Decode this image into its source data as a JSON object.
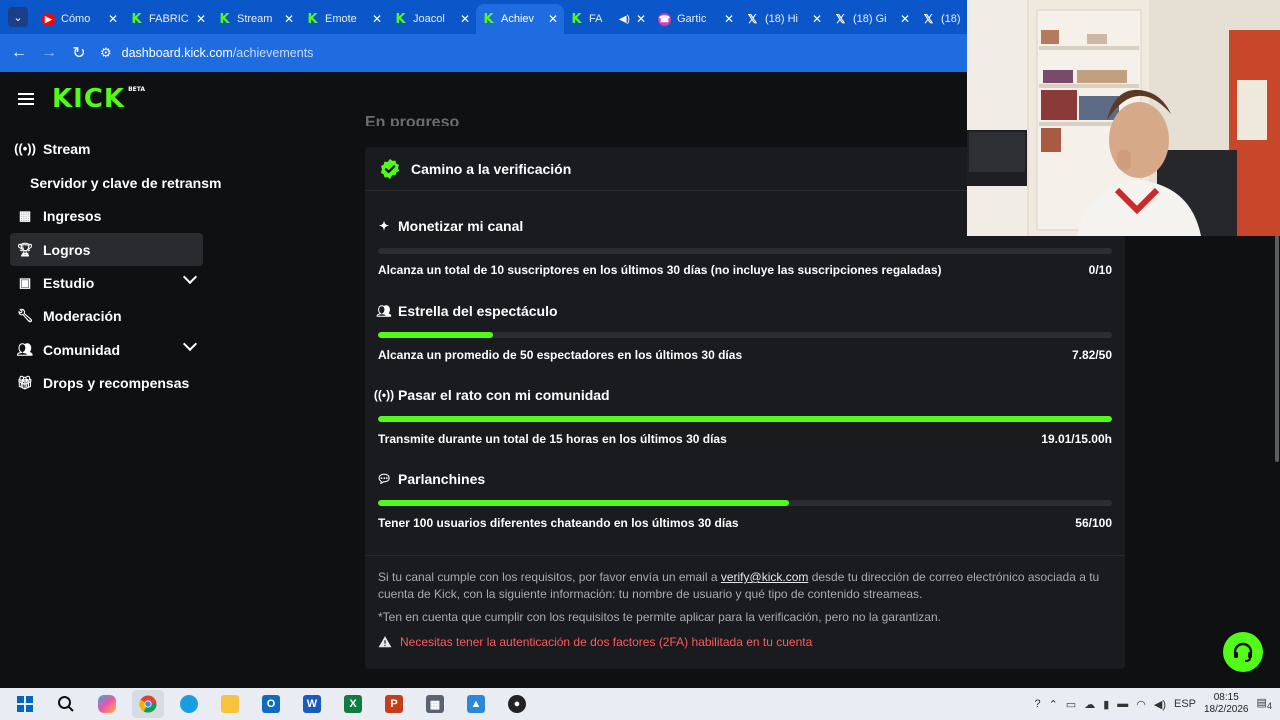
{
  "browser": {
    "tabs": [
      {
        "icon": "youtube-icon",
        "title": "Cómo",
        "active": false
      },
      {
        "icon": "kick-icon",
        "title": "FABRIC",
        "active": false
      },
      {
        "icon": "kick-icon",
        "title": "Stream",
        "active": false
      },
      {
        "icon": "kick-icon",
        "title": "Emote",
        "active": false
      },
      {
        "icon": "kick-icon",
        "title": "Joacol",
        "active": false
      },
      {
        "icon": "kick-icon",
        "title": "Achiev",
        "active": true
      },
      {
        "icon": "kick-icon",
        "title": "FA",
        "active": false,
        "audio": true
      },
      {
        "icon": "gartic-icon",
        "title": "Gartic",
        "active": false
      },
      {
        "icon": "x-icon",
        "title": "(18) Hi",
        "active": false
      },
      {
        "icon": "x-icon",
        "title": "(18) Gi",
        "active": false
      },
      {
        "icon": "x-icon",
        "title": "(18)",
        "active": false
      }
    ],
    "url_host": "dashboard.kick.com",
    "url_path": "/achievements"
  },
  "brand": {
    "logo": "KICK",
    "beta": "BETA",
    "accent": "#53fc18"
  },
  "sidebar": {
    "items": [
      {
        "label": "Stream",
        "icon": "broadcast-icon"
      },
      {
        "label": "Servidor y clave de retransm",
        "sub": true
      },
      {
        "label": "Ingresos",
        "icon": "chart-icon"
      },
      {
        "label": "Logros",
        "icon": "trophy-icon",
        "active": true
      },
      {
        "label": "Estudio",
        "icon": "studio-icon",
        "expandable": true
      },
      {
        "label": "Moderación",
        "icon": "wrench-icon"
      },
      {
        "label": "Comunidad",
        "icon": "community-icon",
        "expandable": true
      },
      {
        "label": "Drops y recompensas",
        "icon": "gift-icon"
      }
    ]
  },
  "main": {
    "section_heading": "En progreso",
    "card_title": "Camino a la verificación",
    "goals": [
      {
        "title": "Monetizar mi canal",
        "icon": "sparkle-icon",
        "desc": "Alcanza un total de 10 suscriptores en los últimos 30 días (no incluye las suscripciones regaladas)",
        "progress_text": "0/10",
        "progress": 0.0
      },
      {
        "title": "Estrella del espectáculo",
        "icon": "viewers-icon",
        "desc": "Alcanza un promedio de 50 espectadores en los últimos 30 días",
        "progress_text": "7.82/50",
        "progress": 0.156
      },
      {
        "title": "Pasar el rato con mi comunidad",
        "icon": "broadcast-icon",
        "desc": "Transmite durante un total de 15 horas en los últimos 30 días",
        "progress_text": "19.01/15.00h",
        "progress": 1.0
      },
      {
        "title": "Parlanchines",
        "icon": "chat-icon",
        "desc": "Tener 100 usuarios diferentes chateando en los últimos 30 días",
        "progress_text": "56/100",
        "progress": 0.56
      }
    ],
    "note_1_before": "Si tu canal cumple con los requisitos, por favor envía un email a ",
    "note_1_email": "verify@kick.com",
    "note_1_after": " desde tu dirección de correo electrónico asociada a tu cuenta de Kick, con la siguiente información: tu nombre de usuario y qué tipo de contenido streameas.",
    "note_2": "*Ten en cuenta que cumplir con los requisitos te permite aplicar para la verificación, pero no la garantizan.",
    "warning": "Necesitas tener la autenticación de dos factores (2FA) habilitada en tu cuenta"
  },
  "taskbar": {
    "lang": "ESP",
    "time": "08:15",
    "date": "18/2/2026",
    "notifications": "4"
  }
}
